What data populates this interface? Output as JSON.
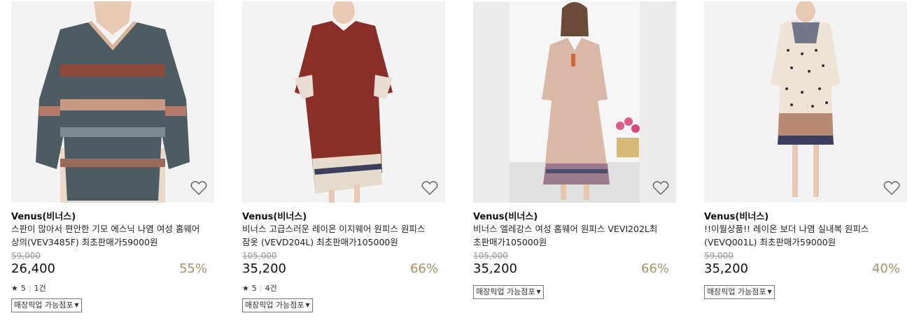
{
  "products": [
    {
      "brand": "Venus(비너스)",
      "name": "스판이 많아서 편안한 기모 에스닉 나염 여성 홈웨어 상의(VEV3485F) 최초판매가59000원",
      "original_price": "59,000",
      "price": "26,400",
      "discount": "55%",
      "rating": "5",
      "reviews": "1건",
      "pickup_label": "매장픽업 가능점포",
      "wishlist_icon": "heart-icon"
    },
    {
      "brand": "Venus(비너스)",
      "name": "비너스 고급스러운 레이온 이지웨어 원피스 원피스잠옷 (VEVD204L) 최초판매가105000원",
      "original_price": "105,000",
      "price": "35,200",
      "discount": "66%",
      "rating": "5",
      "reviews": "4건",
      "pickup_label": "매장픽업 가능점포",
      "wishlist_icon": "heart-icon"
    },
    {
      "brand": "Venus(비너스)",
      "name": "비너스 엘레강스 여성 홈웨어 원피스 VEVI202L최초판매가105000원",
      "original_price": "105,000",
      "price": "35,200",
      "discount": "66%",
      "pickup_label": "매장픽업 가능점포",
      "wishlist_icon": "heart-icon"
    },
    {
      "brand": "Venus(비너스)",
      "name": "!!이월상품!! 레이온 보더 나염 실내복 원피스 (VEVQ001L) 최초판매가59000원",
      "original_price": "59,000",
      "price": "35,200",
      "discount": "40%",
      "pickup_label": "매장픽업 가능점포",
      "wishlist_icon": "heart-icon"
    }
  ],
  "colors": {
    "discount": "#a6936a",
    "original_price": "#999999",
    "image_background": "#f4f4f4"
  },
  "icons": {
    "star": "★",
    "caret": "▼"
  }
}
